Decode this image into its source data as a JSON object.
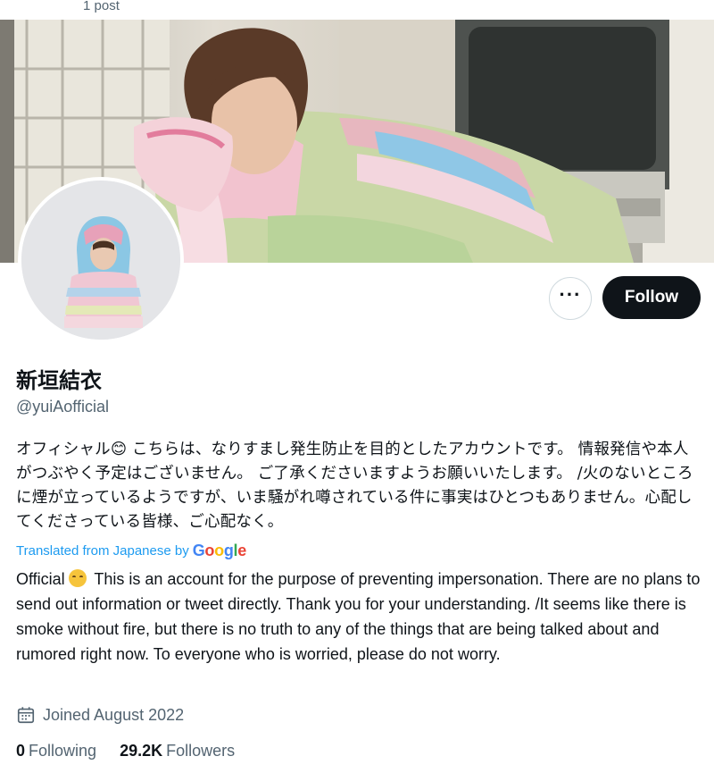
{
  "header": {
    "post_count": "1 post"
  },
  "profile": {
    "display_name": "新垣結衣",
    "handle": "@yuiAofficial"
  },
  "actions": {
    "more_label": "···",
    "follow_label": "Follow"
  },
  "bio": {
    "original": "オフィシャル😊 こちらは、なりすまし発生防止を目的としたアカウントです。 情報発信や本人がつぶやく予定はございません。 ご了承くださいますようお願いいたします。 /火のないところに煙が立っているようですが、いま騒がれ噂されている件に事実はひとつもありません。心配してくださっている皆様、ご心配なく。",
    "translated_label": "Translated from Japanese by",
    "translated_provider": "Google",
    "translation_prefix": "Official",
    "translation": "This is an account for the purpose of preventing impersonation. There are no plans to send out information or tweet directly. Thank you for your understanding. /It seems like there is smoke without fire, but there is no truth to any of the things that are being talked about and rumored right now. To everyone who is worried, please do not worry."
  },
  "meta": {
    "joined": "Joined August 2022",
    "calendar_icon": "calendar-icon"
  },
  "stats": {
    "following_count": "0",
    "following_label": "Following",
    "followers_count": "29.2K",
    "followers_label": "Followers"
  },
  "colors": {
    "follow_bg": "#0f1419",
    "secondary_text": "#536471",
    "link": "#1d9bf0"
  }
}
